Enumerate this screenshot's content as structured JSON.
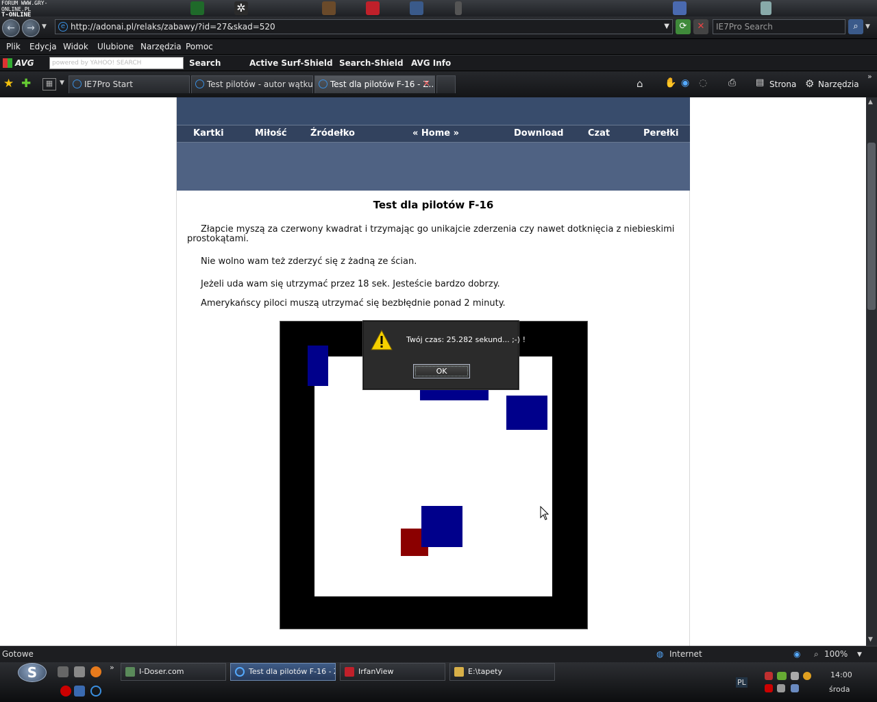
{
  "desktop": {
    "forum_logo_line1": "FORUM WWW.GRY-ONLINE.PL",
    "forum_logo_line2": "T-ONLINE"
  },
  "browser": {
    "address": "http://adonai.pl/relaks/zabawy/?id=27&skad=520",
    "search_placeholder": "IE7Pro Search",
    "menu": [
      "Plik",
      "Edycja",
      "Widok",
      "Ulubione",
      "Narzędzia",
      "Pomoc"
    ],
    "avg_toolbar": {
      "avg_label": "AVG",
      "yahoo_placeholder": "powered by YAHOO! SEARCH",
      "search": "Search",
      "surf_shield": "Active  Surf-Shield",
      "search_shield": "Search-Shield",
      "avg_info": "AVG Info"
    },
    "tabs": [
      {
        "label": "IE7Pro Start"
      },
      {
        "label": "Test pilotów - autor wątku: ..."
      },
      {
        "label": "Test dla pilotów F-16 - Z..."
      }
    ],
    "command_bar": {
      "page": "Strona",
      "tools": "Narzędzia"
    },
    "status": {
      "left": "Gotowe",
      "zone": "Internet",
      "zoom": "100%"
    }
  },
  "site": {
    "nav": [
      "Kartki",
      "Miłość",
      "Źródełko",
      "« Home »",
      "Download",
      "Czat",
      "Perełki"
    ],
    "title": "Test dla pilotów F-16",
    "paragraphs": [
      "Złapcie myszą za czerwony kwadrat i trzymając go unikajcie zderzenia czy nawet dotknięcia z niebieskimi prostokątami.",
      "Nie wolno wam też zderzyć się z żadną ze ścian.",
      "Jeżeli uda wam się utrzymać przez 18 sek. Jesteście bardzo dobrzy.",
      "Amerykańscy piloci muszą utrzymać się bezbłędnie ponad 2 minuty."
    ]
  },
  "dialog": {
    "message": "Twój czas: 25.282 sekund... ;-) !",
    "ok": "OK"
  },
  "taskbar": {
    "tasks": [
      {
        "label": "I-Doser.com"
      },
      {
        "label": "Test dla pilotów F-16 - Z..."
      },
      {
        "label": "IrfanView"
      },
      {
        "label": "E:\\tapety"
      }
    ],
    "lang": "PL",
    "time": "14:00",
    "day": "środa"
  },
  "colors": {
    "game_blue": "#00008b",
    "game_red": "#8b0000",
    "banner": "#384c6c"
  }
}
